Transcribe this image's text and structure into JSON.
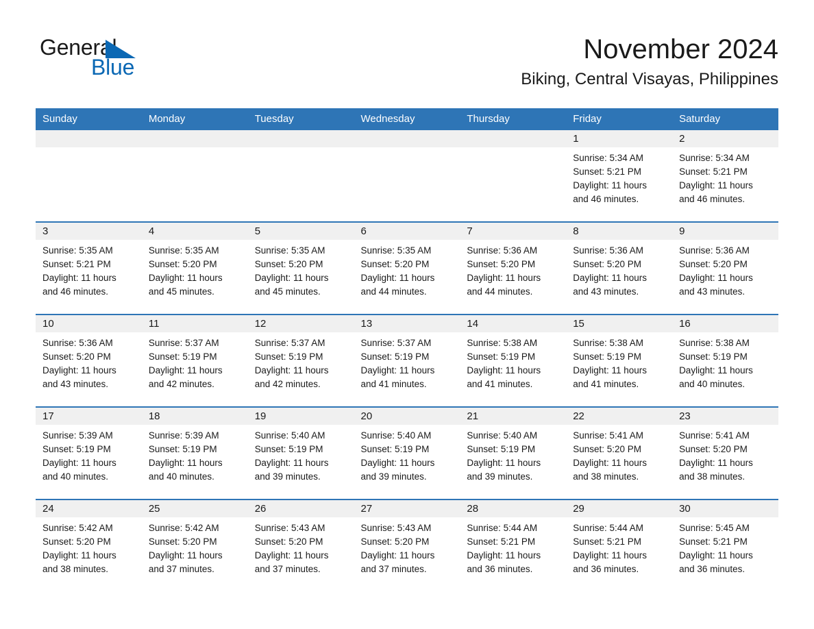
{
  "brand": {
    "name_part1": "General",
    "name_part2": "Blue",
    "triangle_color": "#0B68B4",
    "text_color": "#1a1a1a"
  },
  "header": {
    "month_title": "November 2024",
    "location": "Biking, Central Visayas, Philippines"
  },
  "theme": {
    "header_blue": "#2E75B6",
    "date_band_gray": "#F0F0F0",
    "cell_white": "#FFFFFF",
    "text_dark": "#1a1a1a",
    "brand_blue": "#0B68B4"
  },
  "calendar": {
    "weekday_headers": [
      "Sunday",
      "Monday",
      "Tuesday",
      "Wednesday",
      "Thursday",
      "Friday",
      "Saturday"
    ],
    "weeks": [
      [
        {
          "day": "",
          "sunrise": "",
          "sunset": "",
          "daylight_line1": "",
          "daylight_line2": "",
          "empty": true
        },
        {
          "day": "",
          "sunrise": "",
          "sunset": "",
          "daylight_line1": "",
          "daylight_line2": "",
          "empty": true
        },
        {
          "day": "",
          "sunrise": "",
          "sunset": "",
          "daylight_line1": "",
          "daylight_line2": "",
          "empty": true
        },
        {
          "day": "",
          "sunrise": "",
          "sunset": "",
          "daylight_line1": "",
          "daylight_line2": "",
          "empty": true
        },
        {
          "day": "",
          "sunrise": "",
          "sunset": "",
          "daylight_line1": "",
          "daylight_line2": "",
          "empty": true
        },
        {
          "day": "1",
          "sunrise": "Sunrise: 5:34 AM",
          "sunset": "Sunset: 5:21 PM",
          "daylight_line1": "Daylight: 11 hours",
          "daylight_line2": "and 46 minutes.",
          "empty": false
        },
        {
          "day": "2",
          "sunrise": "Sunrise: 5:34 AM",
          "sunset": "Sunset: 5:21 PM",
          "daylight_line1": "Daylight: 11 hours",
          "daylight_line2": "and 46 minutes.",
          "empty": false
        }
      ],
      [
        {
          "day": "3",
          "sunrise": "Sunrise: 5:35 AM",
          "sunset": "Sunset: 5:21 PM",
          "daylight_line1": "Daylight: 11 hours",
          "daylight_line2": "and 46 minutes.",
          "empty": false
        },
        {
          "day": "4",
          "sunrise": "Sunrise: 5:35 AM",
          "sunset": "Sunset: 5:20 PM",
          "daylight_line1": "Daylight: 11 hours",
          "daylight_line2": "and 45 minutes.",
          "empty": false
        },
        {
          "day": "5",
          "sunrise": "Sunrise: 5:35 AM",
          "sunset": "Sunset: 5:20 PM",
          "daylight_line1": "Daylight: 11 hours",
          "daylight_line2": "and 45 minutes.",
          "empty": false
        },
        {
          "day": "6",
          "sunrise": "Sunrise: 5:35 AM",
          "sunset": "Sunset: 5:20 PM",
          "daylight_line1": "Daylight: 11 hours",
          "daylight_line2": "and 44 minutes.",
          "empty": false
        },
        {
          "day": "7",
          "sunrise": "Sunrise: 5:36 AM",
          "sunset": "Sunset: 5:20 PM",
          "daylight_line1": "Daylight: 11 hours",
          "daylight_line2": "and 44 minutes.",
          "empty": false
        },
        {
          "day": "8",
          "sunrise": "Sunrise: 5:36 AM",
          "sunset": "Sunset: 5:20 PM",
          "daylight_line1": "Daylight: 11 hours",
          "daylight_line2": "and 43 minutes.",
          "empty": false
        },
        {
          "day": "9",
          "sunrise": "Sunrise: 5:36 AM",
          "sunset": "Sunset: 5:20 PM",
          "daylight_line1": "Daylight: 11 hours",
          "daylight_line2": "and 43 minutes.",
          "empty": false
        }
      ],
      [
        {
          "day": "10",
          "sunrise": "Sunrise: 5:36 AM",
          "sunset": "Sunset: 5:20 PM",
          "daylight_line1": "Daylight: 11 hours",
          "daylight_line2": "and 43 minutes.",
          "empty": false
        },
        {
          "day": "11",
          "sunrise": "Sunrise: 5:37 AM",
          "sunset": "Sunset: 5:19 PM",
          "daylight_line1": "Daylight: 11 hours",
          "daylight_line2": "and 42 minutes.",
          "empty": false
        },
        {
          "day": "12",
          "sunrise": "Sunrise: 5:37 AM",
          "sunset": "Sunset: 5:19 PM",
          "daylight_line1": "Daylight: 11 hours",
          "daylight_line2": "and 42 minutes.",
          "empty": false
        },
        {
          "day": "13",
          "sunrise": "Sunrise: 5:37 AM",
          "sunset": "Sunset: 5:19 PM",
          "daylight_line1": "Daylight: 11 hours",
          "daylight_line2": "and 41 minutes.",
          "empty": false
        },
        {
          "day": "14",
          "sunrise": "Sunrise: 5:38 AM",
          "sunset": "Sunset: 5:19 PM",
          "daylight_line1": "Daylight: 11 hours",
          "daylight_line2": "and 41 minutes.",
          "empty": false
        },
        {
          "day": "15",
          "sunrise": "Sunrise: 5:38 AM",
          "sunset": "Sunset: 5:19 PM",
          "daylight_line1": "Daylight: 11 hours",
          "daylight_line2": "and 41 minutes.",
          "empty": false
        },
        {
          "day": "16",
          "sunrise": "Sunrise: 5:38 AM",
          "sunset": "Sunset: 5:19 PM",
          "daylight_line1": "Daylight: 11 hours",
          "daylight_line2": "and 40 minutes.",
          "empty": false
        }
      ],
      [
        {
          "day": "17",
          "sunrise": "Sunrise: 5:39 AM",
          "sunset": "Sunset: 5:19 PM",
          "daylight_line1": "Daylight: 11 hours",
          "daylight_line2": "and 40 minutes.",
          "empty": false
        },
        {
          "day": "18",
          "sunrise": "Sunrise: 5:39 AM",
          "sunset": "Sunset: 5:19 PM",
          "daylight_line1": "Daylight: 11 hours",
          "daylight_line2": "and 40 minutes.",
          "empty": false
        },
        {
          "day": "19",
          "sunrise": "Sunrise: 5:40 AM",
          "sunset": "Sunset: 5:19 PM",
          "daylight_line1": "Daylight: 11 hours",
          "daylight_line2": "and 39 minutes.",
          "empty": false
        },
        {
          "day": "20",
          "sunrise": "Sunrise: 5:40 AM",
          "sunset": "Sunset: 5:19 PM",
          "daylight_line1": "Daylight: 11 hours",
          "daylight_line2": "and 39 minutes.",
          "empty": false
        },
        {
          "day": "21",
          "sunrise": "Sunrise: 5:40 AM",
          "sunset": "Sunset: 5:19 PM",
          "daylight_line1": "Daylight: 11 hours",
          "daylight_line2": "and 39 minutes.",
          "empty": false
        },
        {
          "day": "22",
          "sunrise": "Sunrise: 5:41 AM",
          "sunset": "Sunset: 5:20 PM",
          "daylight_line1": "Daylight: 11 hours",
          "daylight_line2": "and 38 minutes.",
          "empty": false
        },
        {
          "day": "23",
          "sunrise": "Sunrise: 5:41 AM",
          "sunset": "Sunset: 5:20 PM",
          "daylight_line1": "Daylight: 11 hours",
          "daylight_line2": "and 38 minutes.",
          "empty": false
        }
      ],
      [
        {
          "day": "24",
          "sunrise": "Sunrise: 5:42 AM",
          "sunset": "Sunset: 5:20 PM",
          "daylight_line1": "Daylight: 11 hours",
          "daylight_line2": "and 38 minutes.",
          "empty": false
        },
        {
          "day": "25",
          "sunrise": "Sunrise: 5:42 AM",
          "sunset": "Sunset: 5:20 PM",
          "daylight_line1": "Daylight: 11 hours",
          "daylight_line2": "and 37 minutes.",
          "empty": false
        },
        {
          "day": "26",
          "sunrise": "Sunrise: 5:43 AM",
          "sunset": "Sunset: 5:20 PM",
          "daylight_line1": "Daylight: 11 hours",
          "daylight_line2": "and 37 minutes.",
          "empty": false
        },
        {
          "day": "27",
          "sunrise": "Sunrise: 5:43 AM",
          "sunset": "Sunset: 5:20 PM",
          "daylight_line1": "Daylight: 11 hours",
          "daylight_line2": "and 37 minutes.",
          "empty": false
        },
        {
          "day": "28",
          "sunrise": "Sunrise: 5:44 AM",
          "sunset": "Sunset: 5:21 PM",
          "daylight_line1": "Daylight: 11 hours",
          "daylight_line2": "and 36 minutes.",
          "empty": false
        },
        {
          "day": "29",
          "sunrise": "Sunrise: 5:44 AM",
          "sunset": "Sunset: 5:21 PM",
          "daylight_line1": "Daylight: 11 hours",
          "daylight_line2": "and 36 minutes.",
          "empty": false
        },
        {
          "day": "30",
          "sunrise": "Sunrise: 5:45 AM",
          "sunset": "Sunset: 5:21 PM",
          "daylight_line1": "Daylight: 11 hours",
          "daylight_line2": "and 36 minutes.",
          "empty": false
        }
      ]
    ]
  }
}
